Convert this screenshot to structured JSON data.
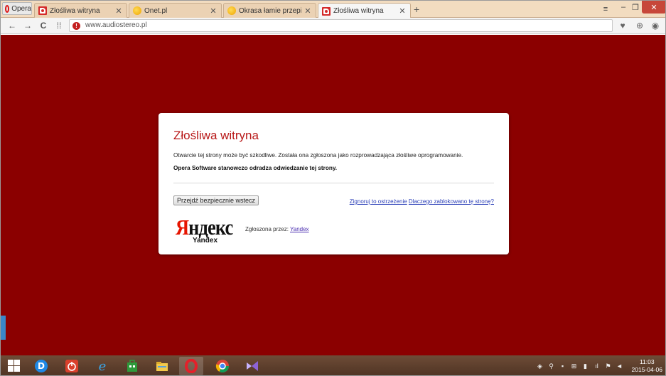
{
  "browser": {
    "menu_label": "Opera",
    "tabs": [
      {
        "title": "Złośliwa witryna",
        "favicon": "opera-warning-icon"
      },
      {
        "title": "Onet.pl",
        "favicon": "onet-icon"
      },
      {
        "title": "Okrasa łamie przepisy - W",
        "favicon": "onet-icon"
      },
      {
        "title": "Złośliwa witryna",
        "favicon": "opera-warning-icon",
        "active": true
      }
    ],
    "url": "www.audiostereo.pl"
  },
  "warning": {
    "title": "Złośliwa witryna",
    "description": "Otwarcie tej strony może być szkodliwe. Została ona zgłoszona jako rozprowadzająca złośliwe oprogramowanie.",
    "recommendation": "Opera Software stanowczo odradza odwiedzanie tej strony.",
    "back_button": "Przejdź bezpiecznie wstecz",
    "ignore_link": "Zignoruj to ostrzeżenie",
    "why_link": "Dlaczego zablokowano tę stronę?",
    "provider_logo": {
      "word_first": "Я",
      "word_rest": "ндекс",
      "sub": "Yandex"
    },
    "reported_by_label": "Zgłoszona przez:",
    "reported_by_link": "Yandex"
  },
  "taskbar": {
    "clock_time": "11:03",
    "clock_date": "2015-04-06"
  },
  "colors": {
    "page_background": "#8b0000",
    "title_red": "#b81919",
    "link_blue": "#2b3fb8"
  }
}
